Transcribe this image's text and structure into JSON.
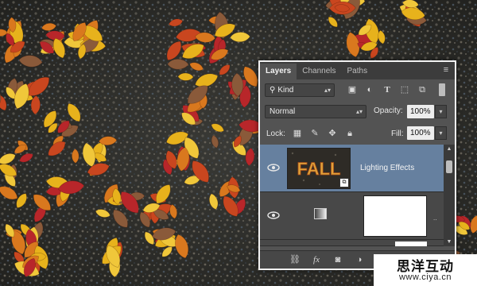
{
  "panel": {
    "tabs": [
      {
        "label": "Layers",
        "active": true
      },
      {
        "label": "Channels",
        "active": false
      },
      {
        "label": "Paths",
        "active": false
      }
    ],
    "filter": {
      "value": "Kind",
      "icon": "search-icon"
    },
    "filter_icons": [
      "image-filter-icon",
      "adjustment-filter-icon",
      "type-filter-icon",
      "shape-filter-icon",
      "smart-object-filter-icon"
    ],
    "blend_mode": "Normal",
    "opacity": {
      "label": "Opacity:",
      "value": "100%"
    },
    "lock": {
      "label": "Lock:"
    },
    "fill": {
      "label": "Fill:",
      "value": "100%"
    },
    "layers": [
      {
        "name": "Lighting Effects",
        "thumbnail_text": "FALL",
        "selected": true,
        "visible": true
      },
      {
        "name": "",
        "selected": false,
        "visible": true
      }
    ],
    "footer_icons": [
      "link-icon",
      "fx-icon",
      "mask-icon",
      "adjustment-icon",
      "folder-icon",
      "new-layer-icon",
      "trash-icon"
    ]
  },
  "watermark": {
    "title": "思洋互动",
    "url": "www.ciya.cn"
  },
  "colors": {
    "selected_layer": "#66809f",
    "panel_bg": "#535353",
    "leaf_yellow": "#e7b21c",
    "leaf_red": "#b8262a",
    "leaf_orange": "#d9781e"
  }
}
